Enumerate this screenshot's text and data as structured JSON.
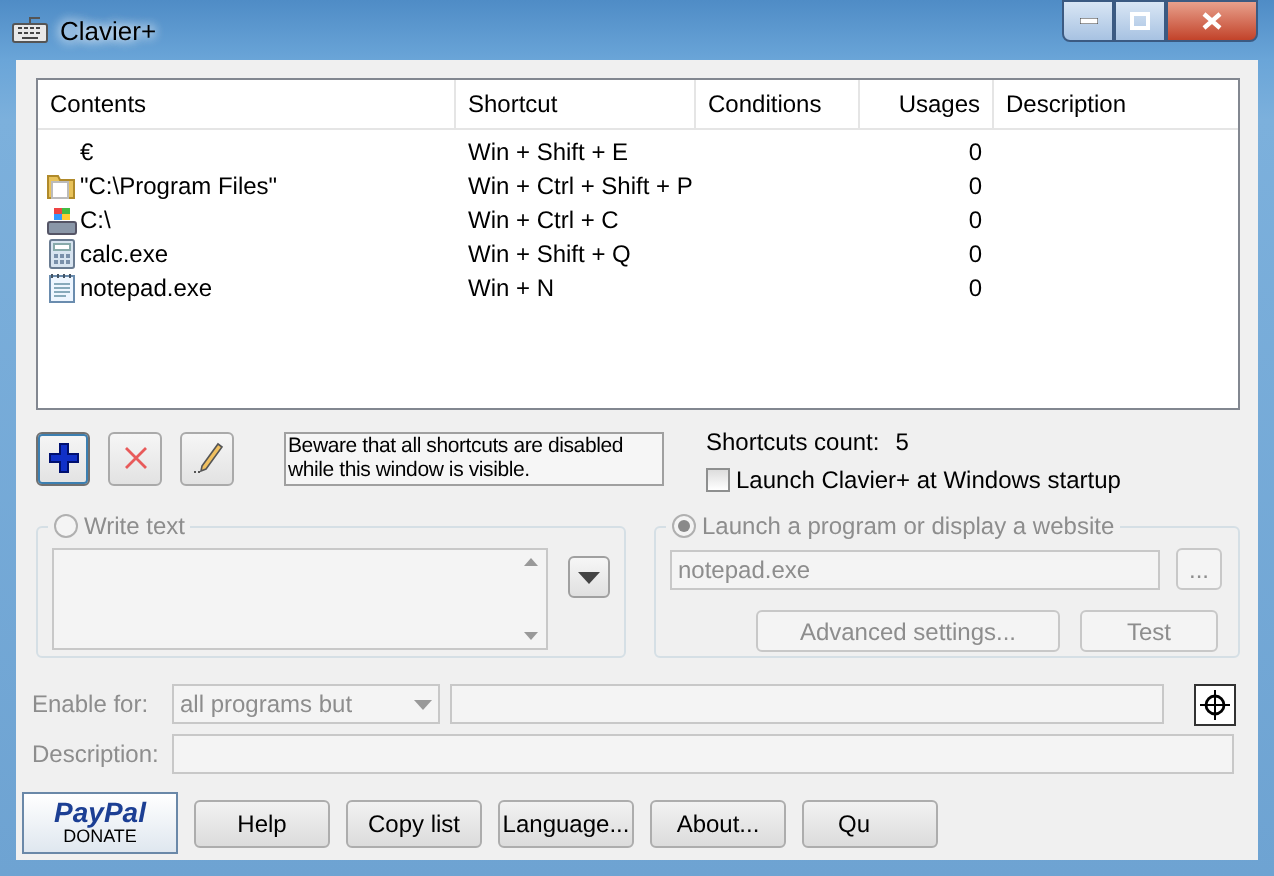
{
  "window": {
    "title": "Clavier+"
  },
  "table": {
    "columns": [
      "Contents",
      "Shortcut",
      "Conditions",
      "Usages",
      "Description"
    ],
    "rows": [
      {
        "kind": "text",
        "contents": "€",
        "shortcut": "Win + Shift + E",
        "usages": "0"
      },
      {
        "kind": "folder",
        "contents": "\"C:\\Program Files\"",
        "shortcut": "Win + Ctrl + Shift + P",
        "usages": "0"
      },
      {
        "kind": "drive",
        "contents": "C:\\",
        "shortcut": "Win + Ctrl + C",
        "usages": "0"
      },
      {
        "kind": "calculator",
        "contents": "calc.exe",
        "shortcut": "Win + Shift + Q",
        "usages": "0"
      },
      {
        "kind": "notepad",
        "contents": "notepad.exe",
        "shortcut": "Win + N",
        "usages": "0"
      }
    ]
  },
  "notice": "Beware that all shortcuts are disabled while this window is visible.",
  "shortcuts_count": {
    "label": "Shortcuts count:",
    "value": "5"
  },
  "startup": {
    "label": "Launch Clavier+ at Windows startup",
    "checked": false
  },
  "write_text": {
    "label": "Write text",
    "selected": false,
    "disabled": true
  },
  "launch": {
    "label": "Launch a program or display a website",
    "selected": true,
    "disabled": true,
    "value": "notepad.exe",
    "browse": "...",
    "buttons": [
      {
        "label": "Advanced settings...",
        "disabled": true
      },
      {
        "label": "Test",
        "disabled": true
      }
    ]
  },
  "enable_for": {
    "label": "Enable for:",
    "value": "all programs but",
    "disabled": true
  },
  "description": {
    "label": "Description:",
    "disabled": true
  },
  "donate": {
    "brand": "PayPal",
    "label": "DONATE"
  },
  "buttons": [
    {
      "label": "Help"
    },
    {
      "label": "Copy list"
    },
    {
      "label": "Language..."
    },
    {
      "label": "About..."
    },
    {
      "label": "Qu"
    }
  ]
}
